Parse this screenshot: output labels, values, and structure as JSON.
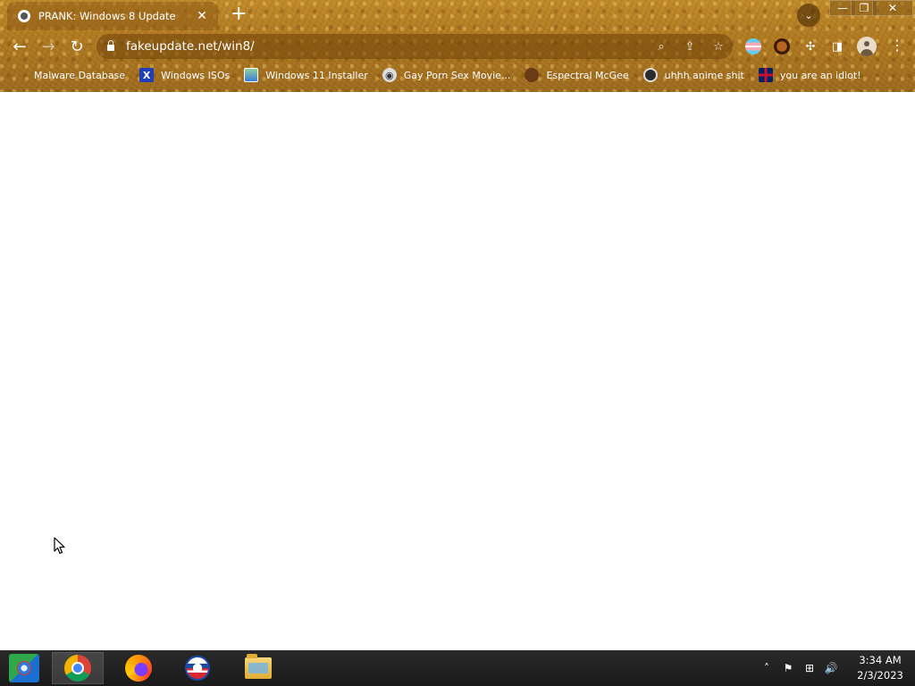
{
  "browser": {
    "tab": {
      "title": "PRANK: Windows 8 Update",
      "close": "✕"
    },
    "new_tab": "+",
    "tab_search": "⌄",
    "window_controls": {
      "minimize": "—",
      "maximize": "❐",
      "close": "✕"
    },
    "nav": {
      "back": "←",
      "forward": "→",
      "reload": "↻"
    },
    "omnibox": {
      "url": "fakeupdate.net/win8/",
      "search": "⌕",
      "share": "⇪",
      "star": "☆"
    },
    "extensions": {
      "puzzle": "✣",
      "sidebar": "◨"
    },
    "menu": "⋮",
    "bookmarks": [
      {
        "label": "Malware Database",
        "icon": "malware-icon",
        "glyph": ""
      },
      {
        "label": "Windows ISOs",
        "icon": "x-icon",
        "glyph": "X"
      },
      {
        "label": "Windows 11 Installer",
        "icon": "installer-icon",
        "glyph": ""
      },
      {
        "label": "Gay Porn Sex Movie...",
        "icon": "film-icon",
        "glyph": "◉"
      },
      {
        "label": "Espectral McGee",
        "icon": "face-icon",
        "glyph": ""
      },
      {
        "label": "uhhh anime shit",
        "icon": "anime-icon",
        "glyph": ""
      },
      {
        "label": "you are an idiot!",
        "icon": "uk-flag-icon",
        "glyph": ""
      }
    ]
  },
  "taskbar": {
    "apps": [
      "chrome",
      "firefox",
      "opera",
      "file-explorer"
    ],
    "active_app": "chrome",
    "tray": {
      "chevron": "˄",
      "flag": "⚑",
      "network": "⊞",
      "volume": "🔊"
    },
    "clock": {
      "time": "3:34 AM",
      "date": "2/3/2023"
    }
  },
  "colors": {
    "theme": "#b07a22",
    "page_bg": "#ffffff",
    "taskbar": "#1f1f1f"
  }
}
